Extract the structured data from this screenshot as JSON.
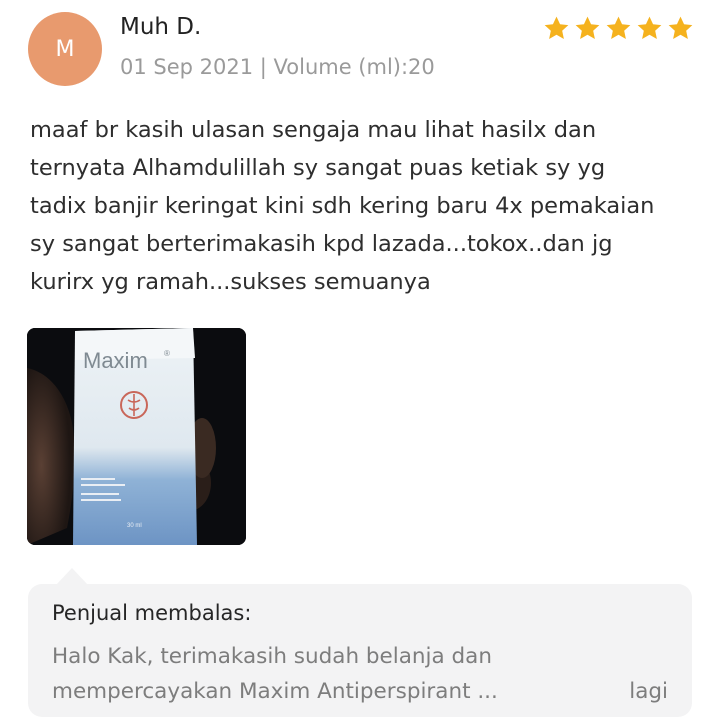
{
  "review": {
    "avatar_initial": "M",
    "reviewer_name": "Muh D.",
    "meta": "01 Sep 2021 | Volume (ml):20",
    "rating": 5,
    "star_color": "#F5B21E",
    "text_lines": [
      "maaf br kasih ulasan sengaja mau lihat hasilx dan",
      "ternyata Alhamdulillah sy sangat puas ketiak sy yg",
      "tadix banjir keringat kini sdh kering baru 4x pemakaian",
      "sy sangat berterimakasih kpd lazada...tokox..dan jg",
      "kurirx yg ramah...sukses semuanya"
    ]
  },
  "photo": {
    "brand": "Maxim",
    "volume_label": "30 ml"
  },
  "seller_reply": {
    "title": "Penjual membalas:",
    "line1": "Halo Kak, terimakasih sudah belanja dan",
    "line2": "mempercayakan Maxim Antiperspirant ...",
    "more_label": "lagi"
  }
}
